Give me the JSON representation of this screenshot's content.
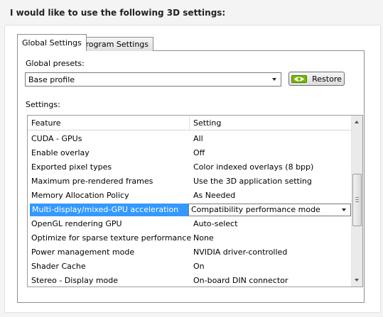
{
  "heading": "I would like to use the following 3D settings:",
  "tabs": [
    {
      "label": "Global Settings",
      "active": true
    },
    {
      "label": "Program Settings",
      "active": false
    }
  ],
  "presets": {
    "label": "Global presets:",
    "selected": "Base profile"
  },
  "restore_label": "Restore",
  "settings_label": "Settings:",
  "table": {
    "columns": [
      "Feature",
      "Setting"
    ],
    "rows": [
      {
        "feature": "CUDA - GPUs",
        "setting": "All"
      },
      {
        "feature": "Enable overlay",
        "setting": "Off"
      },
      {
        "feature": "Exported pixel types",
        "setting": "Color indexed overlays (8 bpp)"
      },
      {
        "feature": "Maximum pre-rendered frames",
        "setting": "Use the 3D application setting"
      },
      {
        "feature": "Memory Allocation Policy",
        "setting": "As Needed"
      },
      {
        "feature": "Multi-display/mixed-GPU acceleration",
        "setting": "Compatibility performance mode",
        "selected": true
      },
      {
        "feature": "OpenGL rendering GPU",
        "setting": "Auto-select"
      },
      {
        "feature": "Optimize for sparse texture performance",
        "setting": "None"
      },
      {
        "feature": "Power management mode",
        "setting": "NVIDIA driver-controlled"
      },
      {
        "feature": "Shader Cache",
        "setting": "On"
      },
      {
        "feature": "Stereo - Display mode",
        "setting": "On-board DIN connector"
      }
    ]
  },
  "colors": {
    "selection": "#3399ff",
    "nvidia_green": "#76b900"
  }
}
